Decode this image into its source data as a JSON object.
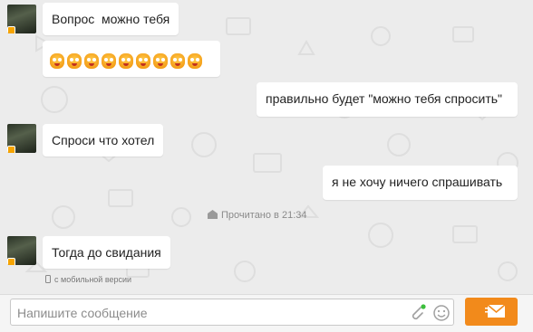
{
  "messages": [
    {
      "from": "them",
      "text": "Вопрос  можно тебя"
    },
    {
      "from": "them",
      "type": "emoji_row",
      "emoji_count": 9
    },
    {
      "from": "me",
      "text": "правильно будет \"можно тебя спросить\""
    },
    {
      "from": "them",
      "text": "Спроси что хотел"
    },
    {
      "from": "me",
      "text": "я не хочу ничего спрашивать"
    },
    {
      "from": "them",
      "text": "Тогда до свидания"
    }
  ],
  "read_status": "Прочитано в 21:34",
  "mobile_note": "с мобильной версии",
  "composer": {
    "placeholder": "Напишите сообщение",
    "icons": [
      "attachment-icon",
      "smiley-icon",
      "envelope-icon"
    ]
  },
  "colors": {
    "accent": "#f28a1b",
    "bubble": "#ffffff",
    "background": "#ececec"
  }
}
